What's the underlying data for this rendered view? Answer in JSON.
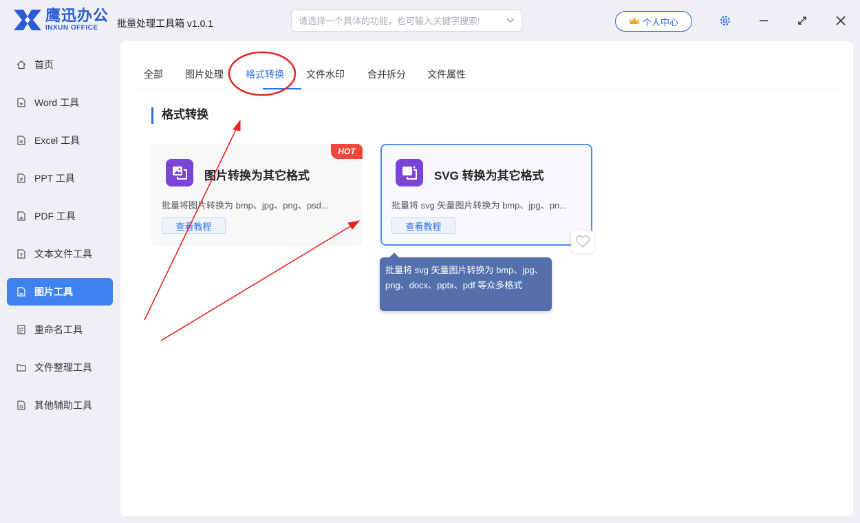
{
  "app": {
    "logo_cn": "鹰迅办公",
    "logo_en": "INXUN OFFICE",
    "title": "批量处理工具箱 v1.0.1",
    "brand_color": "#2a5bd7",
    "accent_color": "#3f82f0"
  },
  "header": {
    "search_placeholder": "请选择一个具体的功能，也可输入关键字搜索!",
    "user_center_label": "个人中心",
    "icons": [
      "crown-icon",
      "gear-icon",
      "minimize-icon",
      "maximize-icon",
      "close-icon"
    ]
  },
  "sidebar": {
    "items": [
      {
        "label": "首页",
        "icon": "home-icon"
      },
      {
        "label": "Word 工具",
        "icon": "file-icon"
      },
      {
        "label": "Excel 工具",
        "icon": "file-icon"
      },
      {
        "label": "PPT 工具",
        "icon": "file-icon"
      },
      {
        "label": "PDF 工具",
        "icon": "file-icon"
      },
      {
        "label": "文本文件工具",
        "icon": "file-icon"
      },
      {
        "label": "图片工具",
        "icon": "image-file-icon",
        "active": true
      },
      {
        "label": "重命名工具",
        "icon": "list-icon"
      },
      {
        "label": "文件整理工具",
        "icon": "folder-icon"
      },
      {
        "label": "其他辅助工具",
        "icon": "tool-file-icon"
      }
    ]
  },
  "main": {
    "tabs": [
      {
        "label": "全部"
      },
      {
        "label": "图片处理"
      },
      {
        "label": "格式转换",
        "active": true
      },
      {
        "label": "文件水印"
      },
      {
        "label": "合并拆分"
      },
      {
        "label": "文件属性"
      }
    ],
    "section_title": "格式转换",
    "cards": [
      {
        "title": "图片转换为其它格式",
        "desc": "批量将图片转换为 bmp、jpg、png、psd...",
        "button": "查看教程",
        "badge": "HOT"
      },
      {
        "title": "SVG 转换为其它格式",
        "desc": "批量将 svg 矢量图片转换为 bmp、jpg、pn...",
        "button": "查看教程"
      }
    ],
    "tooltip": "批量将 svg 矢量图片转换为 bmp、jpg、png、docx、pptx、pdf 等众多格式"
  }
}
